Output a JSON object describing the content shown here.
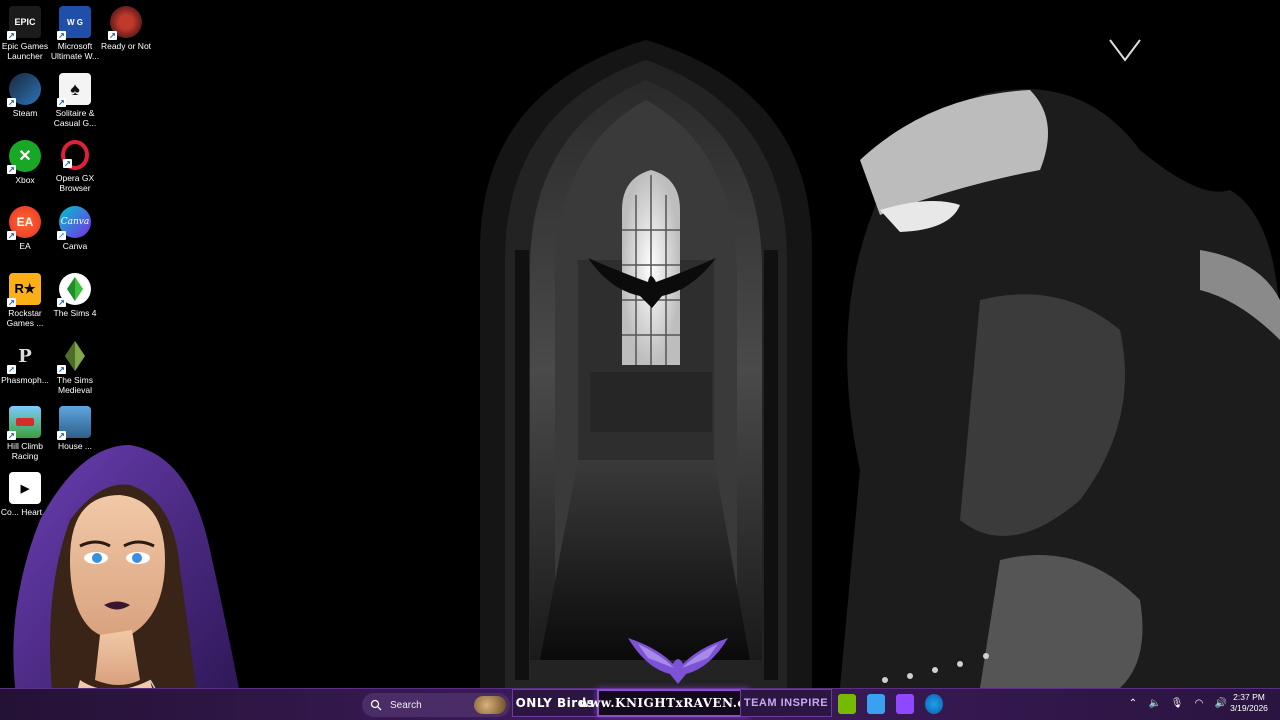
{
  "desktop": {
    "icons": [
      {
        "label": "Epic Games Launcher",
        "icon": "epic-games-icon",
        "glyph": "EPIC"
      },
      {
        "label": "Microsoft Ultimate W...",
        "icon": "microsoft-word-game-icon",
        "glyph": "W G"
      },
      {
        "label": "Ready or Not",
        "icon": "ready-or-not-icon",
        "glyph": ""
      },
      {
        "label": "Steam",
        "icon": "steam-icon",
        "glyph": ""
      },
      {
        "label": "Solitaire & Casual G...",
        "icon": "solitaire-icon",
        "glyph": "♠"
      },
      {
        "label": "Xbox",
        "icon": "xbox-icon",
        "glyph": ""
      },
      {
        "label": "Opera GX Browser",
        "icon": "opera-gx-icon",
        "glyph": ""
      },
      {
        "label": "EA",
        "icon": "ea-icon",
        "glyph": "EA"
      },
      {
        "label": "Canva",
        "icon": "canva-icon",
        "glyph": "Canva"
      },
      {
        "label": "Rockstar Games ...",
        "icon": "rockstar-icon",
        "glyph": "R★"
      },
      {
        "label": "The Sims 4",
        "icon": "sims-4-icon",
        "glyph": ""
      },
      {
        "label": "Phasmoph...",
        "icon": "phasmophobia-icon",
        "glyph": ""
      },
      {
        "label": "The Sims Medieval",
        "icon": "sims-medieval-icon",
        "glyph": ""
      },
      {
        "label": "Hill Climb Racing",
        "icon": "hill-climb-racing-icon",
        "glyph": ""
      },
      {
        "label": "House ...",
        "icon": "house-flipper-icon",
        "glyph": ""
      },
      {
        "label": "Co... Heart...",
        "icon": "partially-hidden-app-icon",
        "glyph": ""
      }
    ]
  },
  "taskbar": {
    "search_label": "Search",
    "banner_onlyfans": "ONLY Birds",
    "banner_site": "www.KNIGHTxRAVEN.com",
    "banner_team": "TEAM INSPIRE",
    "clock_time": "2:37 PM",
    "clock_date": "3/19/2026"
  },
  "colors": {
    "taskbar": "#3a1a57",
    "accent": "#8a4fc9",
    "start": "#2d9bf0"
  }
}
